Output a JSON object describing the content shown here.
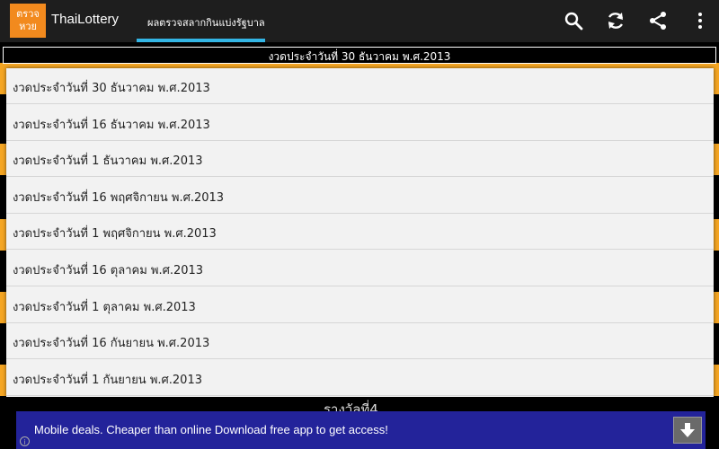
{
  "app": {
    "logo_line1": "ตรวจ",
    "logo_line2": "หวย",
    "title": "ThaiLottery"
  },
  "tab": {
    "label": "ผลตรวจสลากกินแบ่งรัฐบาล"
  },
  "actions": [
    "search-icon",
    "refresh-icon",
    "share-icon",
    "overflow-menu-icon"
  ],
  "selected_draw": "งวดประจำวันที่ 30 ธันวาคม พ.ศ.2013",
  "draws": [
    "งวดประจำวันที่ 30 ธันวาคม พ.ศ.2013",
    "งวดประจำวันที่ 16 ธันวาคม พ.ศ.2013",
    "งวดประจำวันที่ 1 ธันวาคม พ.ศ.2013",
    "งวดประจำวันที่ 16 พฤศจิกายน พ.ศ.2013",
    "งวดประจำวันที่ 1 พฤศจิกายน พ.ศ.2013",
    "งวดประจำวันที่ 16 ตุลาคม พ.ศ.2013",
    "งวดประจำวันที่ 1 ตุลาคม พ.ศ.2013",
    "งวดประจำวันที่ 16 กันยายน พ.ศ.2013",
    "งวดประจำวันที่ 1 กันยายน พ.ศ.2013"
  ],
  "background_peek_text": "รางวัลที่4",
  "ad": {
    "text": "Mobile deals. Cheaper than online Download free app to get access!"
  },
  "colors": {
    "accent": "#33b5e5",
    "orange": "#f5a623",
    "ad_bg": "#23239a"
  }
}
